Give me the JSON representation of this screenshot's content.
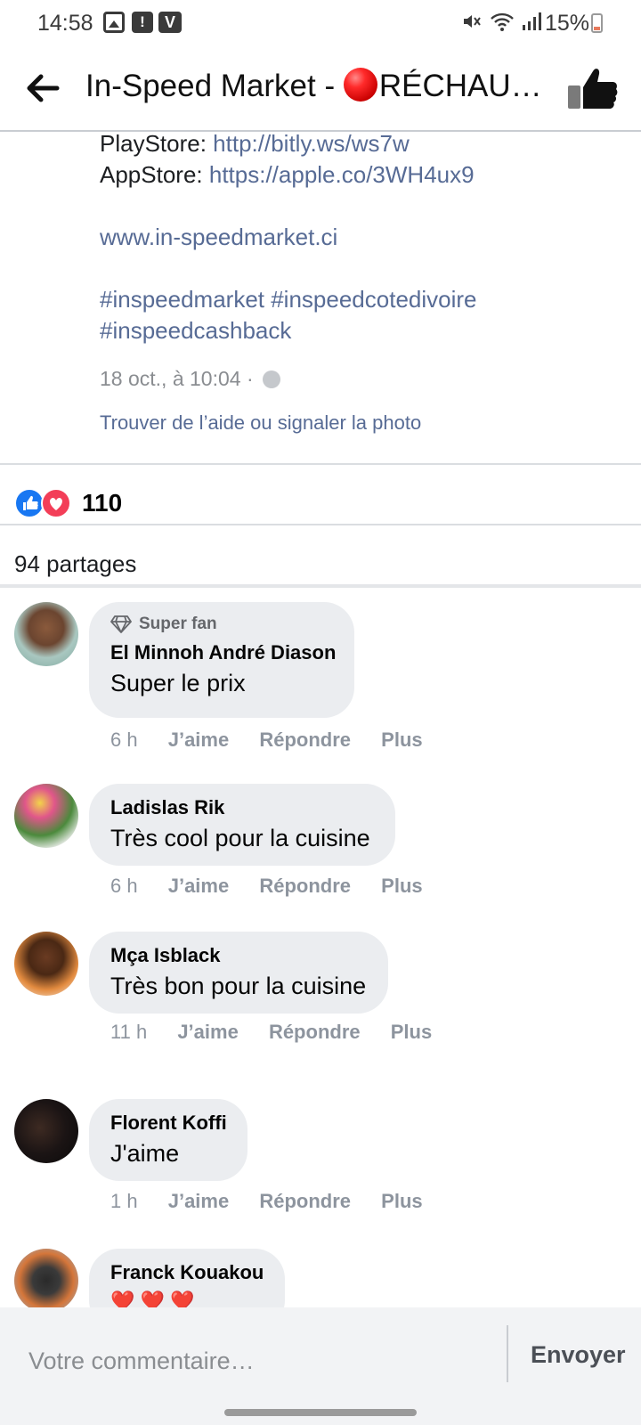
{
  "status_bar": {
    "time": "14:58",
    "battery": "15%",
    "icons": [
      "photo-icon",
      "alert-icon",
      "v-app-icon",
      "mute-icon",
      "wifi-icon",
      "signal-icon",
      "battery-icon"
    ]
  },
  "header": {
    "title_prefix": "In-Speed Market - ",
    "title_rest": "RÉCHAUD...",
    "icons": [
      "back-arrow-icon",
      "red-ball-emoji",
      "thumbs-up-icon"
    ]
  },
  "post": {
    "playstore_label": "PlayStore: ",
    "playstore_link": "http://bitly.ws/ws7w",
    "appstore_label": "AppStore: ",
    "appstore_link": "https://apple.co/3WH4ux9",
    "website": "www.in-speedmarket.ci",
    "hashtags_line1": "#inspeedmarket #inspeedcotedivoire",
    "hashtags_line2": "#inspeedcashback",
    "date": "18 oct., à 10:04 ·",
    "report_link": "Trouver de l’aide ou signaler la photo"
  },
  "reactions": {
    "count": "110",
    "shares": "94 partages"
  },
  "comment_actions": {
    "like": "J’aime",
    "reply": "Répondre",
    "more": "Plus"
  },
  "comments": [
    {
      "badge": "Super fan",
      "author": "El Minnoh André Diason",
      "text": "Super le prix",
      "time": "6 h"
    },
    {
      "author": "Ladislas Rik",
      "text": "Très cool pour la cuisine",
      "time": "6 h"
    },
    {
      "author": "Mça Isblack",
      "text": "Très bon pour la cuisine",
      "time": "11 h"
    },
    {
      "author": "Florent Koffi",
      "text": "J'aime",
      "time": "1 h"
    },
    {
      "author": "Franck Kouakou",
      "text": "❤️ ❤️ ❤️"
    }
  ],
  "composer": {
    "placeholder": "Votre commentaire…",
    "send": "Envoyer"
  },
  "colors": {
    "link": "#576b95",
    "bubble": "#ebedf0",
    "like_blue": "#1877f2",
    "love_red": "#f33e58"
  }
}
